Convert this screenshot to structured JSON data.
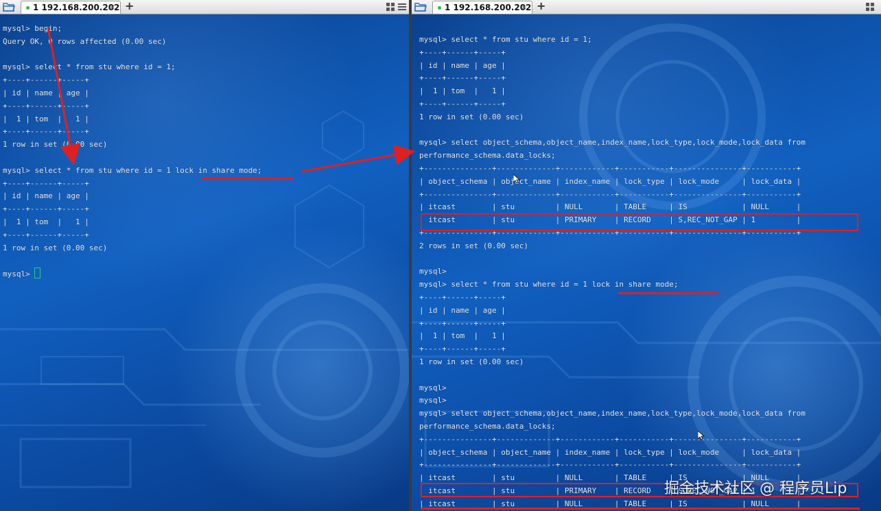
{
  "left_tab": {
    "label": "1 192.168.200.202",
    "close": "×"
  },
  "right_tab": {
    "label": "1 192.168.200.202",
    "close": "×"
  },
  "add_tab": "+",
  "left_terminal": [
    "mysql> begin;",
    "Query OK, 0 rows affected (0.00 sec)",
    "",
    "mysql> select * from stu where id = 1;",
    "+----+------+-----+",
    "| id | name | age |",
    "+----+------+-----+",
    "|  1 | tom  |   1 |",
    "+----+------+-----+",
    "1 row in set (0.00 sec)",
    "",
    "mysql> select * from stu where id = 1 lock in share mode;",
    "+----+------+-----+",
    "| id | name | age |",
    "+----+------+-----+",
    "|  1 | tom  |   1 |",
    "+----+------+-----+",
    "1 row in set (0.00 sec)",
    "",
    "mysql> "
  ],
  "right_terminal": [
    "mysql> select * from stu where id = 1;",
    "+----+------+-----+",
    "| id | name | age |",
    "+----+------+-----+",
    "|  1 | tom  |   1 |",
    "+----+------+-----+",
    "1 row in set (0.00 sec)",
    "",
    "mysql> select object_schema,object_name,index_name,lock_type,lock_mode,lock_data from",
    "performance_schema.data_locks;",
    "+---------------+-------------+------------+-----------+---------------+-----------+",
    "| object_schema | object_name | index_name | lock_type | lock_mode     | lock_data |",
    "+---------------+-------------+------------+-----------+---------------+-----------+",
    "| itcast        | stu         | NULL       | TABLE     | IS            | NULL      |",
    "| itcast        | stu         | PRIMARY    | RECORD    | S,REC_NOT_GAP | 1         |",
    "+---------------+-------------+------------+-----------+---------------+-----------+",
    "2 rows in set (0.00 sec)",
    "",
    "mysql>",
    "mysql> select * from stu where id = 1 lock in share mode;",
    "+----+------+-----+",
    "| id | name | age |",
    "+----+------+-----+",
    "|  1 | tom  |   1 |",
    "+----+------+-----+",
    "1 row in set (0.00 sec)",
    "",
    "mysql>",
    "mysql>",
    "mysql> select object_schema,object_name,index_name,lock_type,lock_mode,lock_data from",
    "performance_schema.data_locks;",
    "+---------------+-------------+------------+-----------+---------------+-----------+",
    "| object_schema | object_name | index_name | lock_type | lock_mode     | lock_data |",
    "+---------------+-------------+------------+-----------+---------------+-----------+",
    "| itcast        | stu         | NULL       | TABLE     | IS            | NULL      |",
    "| itcast        | stu         | PRIMARY    | RECORD    | S,REC_NOT_GAP | 1         |",
    "| itcast        | stu         | NULL       | TABLE     | IS            | NULL      |"
  ],
  "watermark": "掘金技术社区 @ 程序员Lip",
  "colors": {
    "terminal_text": "#e6edf6",
    "annotation_red": "#e02020",
    "tab_dot": "#2dbb3a",
    "terminal_bg": "#0d4a9c"
  },
  "icons": [
    "folder-icon",
    "layout-grid-icon",
    "menu-icon",
    "close-icon",
    "plus-icon",
    "cursor-block-icon"
  ]
}
